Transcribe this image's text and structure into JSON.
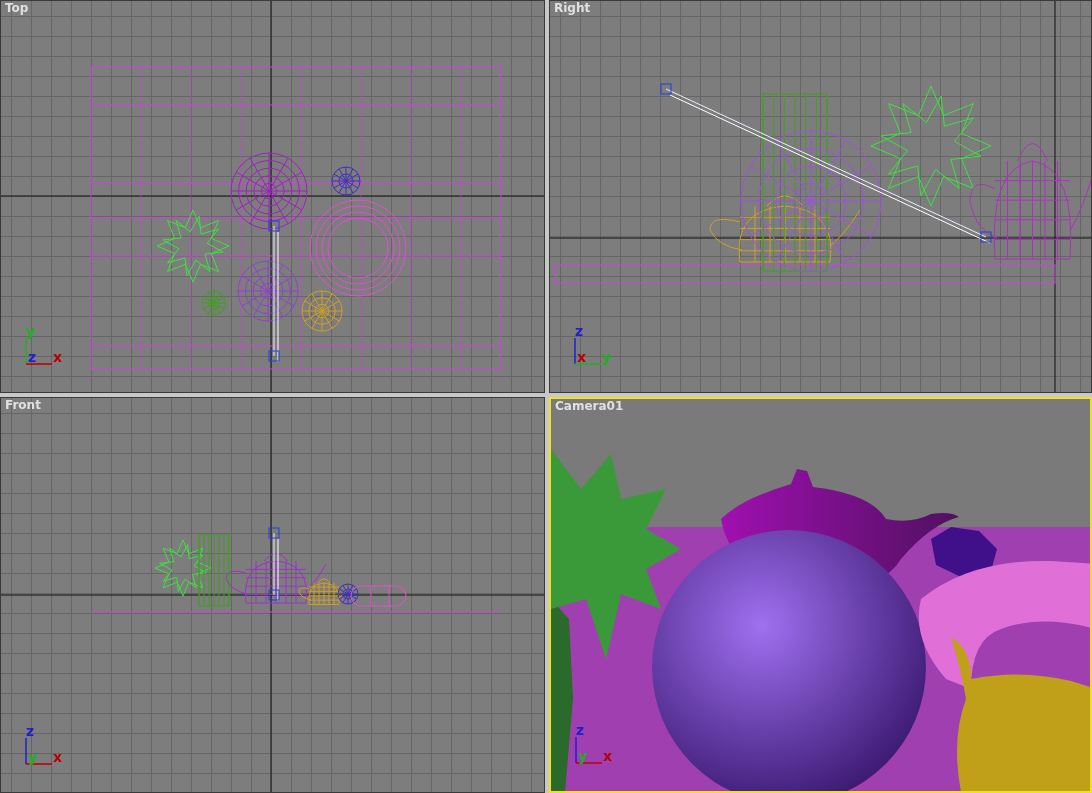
{
  "viewports": [
    {
      "label": "Top",
      "kind": "top",
      "active": false,
      "triad": {
        "vertical": {
          "label": "y",
          "color": "#22b022"
        },
        "corner": {
          "label": "z",
          "color": "#2020d0"
        },
        "horizontal": {
          "label": "x",
          "color": "#b80000"
        }
      }
    },
    {
      "label": "Right",
      "kind": "right",
      "active": false,
      "triad": {
        "vertical": {
          "label": "z",
          "color": "#2020d0"
        },
        "corner": {
          "label": "x",
          "color": "#b80000"
        },
        "horizontal": {
          "label": "y",
          "color": "#22b022"
        }
      }
    },
    {
      "label": "Front",
      "kind": "front",
      "active": false,
      "triad": {
        "vertical": {
          "label": "z",
          "color": "#2020d0"
        },
        "corner": {
          "label": "y",
          "color": "#22b022"
        },
        "horizontal": {
          "label": "x",
          "color": "#b80000"
        }
      }
    },
    {
      "label": "Camera01",
      "kind": "camera",
      "active": true,
      "triad": {
        "vertical": {
          "label": "z",
          "color": "#2020d0"
        },
        "corner": {
          "label": "y",
          "color": "#22b022"
        },
        "horizontal": {
          "label": "x",
          "color": "#b80000"
        }
      }
    }
  ]
}
